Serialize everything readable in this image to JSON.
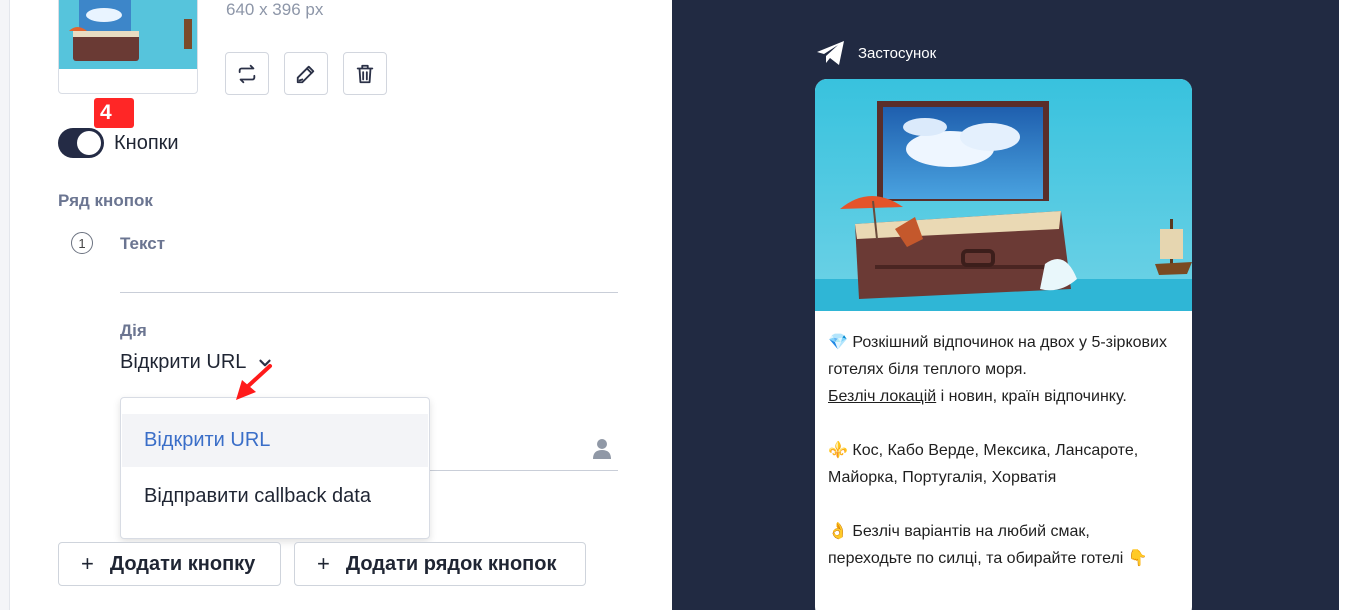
{
  "image": {
    "size_text": "640 x 396 px"
  },
  "badge": "4",
  "toggle": {
    "label": "Кнопки",
    "on": true
  },
  "section": {
    "buttons_row_label": "Ряд кнопок",
    "row_number": "1"
  },
  "fields": {
    "text_label": "Текст",
    "action_label": "Дія"
  },
  "select": {
    "value": "Відкрити URL",
    "options": [
      "Відкрити URL",
      "Відправити callback data"
    ]
  },
  "actions": {
    "add_button": "Додати кнопку",
    "add_row": "Додати рядок кнопок"
  },
  "preview": {
    "app_name": "Застосунок",
    "lines": {
      "l1": "💎 Розкішний відпочинок на двох у 5-зіркових готелях біля теплого моря.",
      "link": "Безліч локацій",
      "l2_rest": " і новин, країн відпочинку.",
      "l3": "⚜️ Кос, Кабо Верде, Мексика, Лансароте, Майорка, Португалія, Хорватія",
      "l4": "👌 Безліч варіантів на любий смак, переходьте по силці, та обирайте готелі 👇"
    }
  },
  "colors": {
    "accent": "#3a6ec8",
    "dark": "#212a42",
    "badge": "#ff2626"
  }
}
